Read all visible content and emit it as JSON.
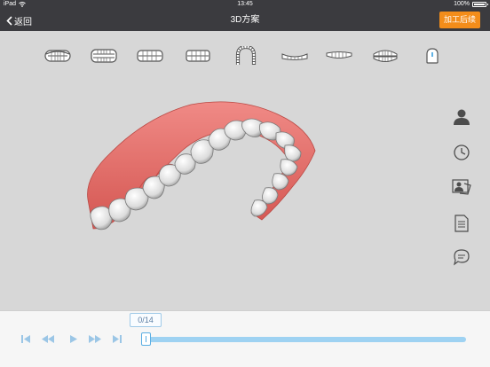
{
  "status": {
    "device": "iPad",
    "wifi_icon": "wifi-icon",
    "time": "13:45",
    "battery": "100%"
  },
  "nav": {
    "back_label": "返回",
    "title": "3D方案",
    "action_label": "加工后续"
  },
  "views": [
    {
      "name": "view-front-closed-icon"
    },
    {
      "name": "view-front-open-icon"
    },
    {
      "name": "view-left-icon"
    },
    {
      "name": "view-right-icon"
    },
    {
      "name": "view-upper-occlusal-icon"
    },
    {
      "name": "view-lower-front-icon"
    },
    {
      "name": "view-upper-front-icon"
    },
    {
      "name": "view-both-arches-icon"
    },
    {
      "name": "view-single-tooth-icon"
    }
  ],
  "side_tools": [
    {
      "name": "patient-icon"
    },
    {
      "name": "clock-icon"
    },
    {
      "name": "photo-card-icon"
    },
    {
      "name": "document-icon"
    },
    {
      "name": "comment-icon"
    }
  ],
  "playback": {
    "frame": "0/14",
    "progress": 0
  },
  "colors": {
    "accent": "#f38d1a",
    "topbar": "#3b3b3f",
    "gum": "#e9716d",
    "track": "#9ed2f2",
    "controls": "#9bc6e6"
  }
}
